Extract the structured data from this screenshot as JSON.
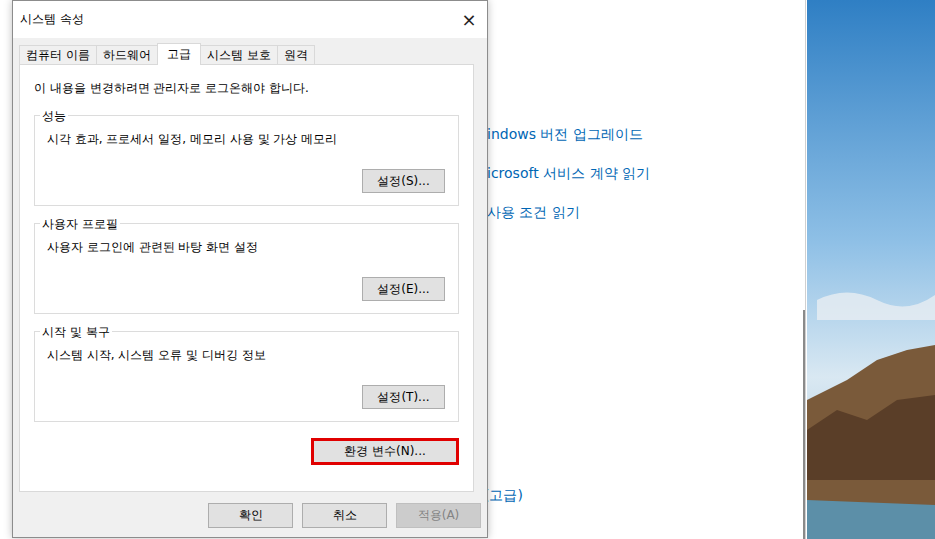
{
  "background_window": {
    "links": [
      "indows 버전 업그레이드",
      "icrosoft 서비스 계약 읽기",
      "사용 조건 읽기"
    ],
    "bottom_link": "(고급)"
  },
  "dialog": {
    "title": "시스템 속성",
    "close": "×",
    "tabs": [
      {
        "label": "컴퓨터 이름",
        "selected": false
      },
      {
        "label": "하드웨어",
        "selected": false
      },
      {
        "label": "고급",
        "selected": true
      },
      {
        "label": "시스템 보호",
        "selected": false
      },
      {
        "label": "원격",
        "selected": false
      }
    ],
    "notice": "이 내용을 변경하려면 관리자로 로그온해야 합니다.",
    "groups": [
      {
        "title": "성능",
        "description": "시각 효과, 프로세서 일정, 메모리 사용 및 가상 메모리",
        "button": "설정(S)..."
      },
      {
        "title": "사용자 프로필",
        "description": "사용자 로그인에 관련된 바탕 화면 설정",
        "button": "설정(E)..."
      },
      {
        "title": "시작 및 복구",
        "description": "시스템 시작, 시스템 오류 및 디버깅 정보",
        "button": "설정(T)..."
      }
    ],
    "env_button": {
      "label": "환경 변수(N)...",
      "highlighted": true
    },
    "buttons": [
      {
        "label": "확인",
        "disabled": false
      },
      {
        "label": "취소",
        "disabled": false
      },
      {
        "label": "적용(A)",
        "disabled": true
      }
    ]
  }
}
